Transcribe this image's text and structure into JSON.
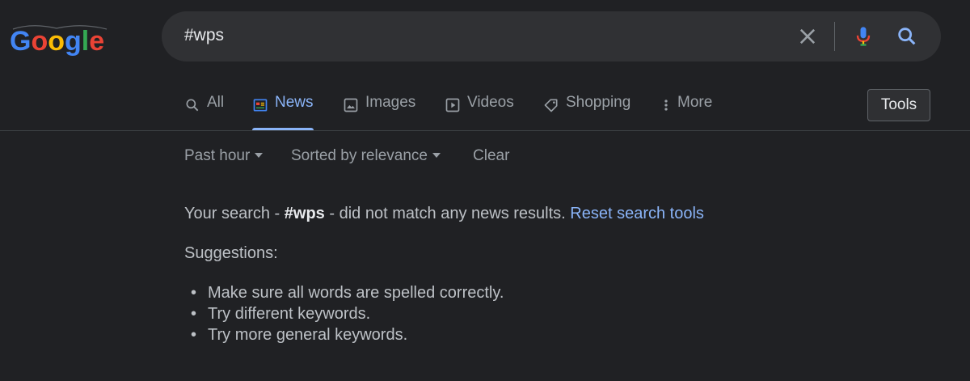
{
  "logo": {
    "text": "Google"
  },
  "search": {
    "query": "#wps"
  },
  "tabs": [
    {
      "label": "All",
      "icon": "search-icon"
    },
    {
      "label": "News",
      "icon": "news-icon",
      "active": true
    },
    {
      "label": "Images",
      "icon": "image-icon"
    },
    {
      "label": "Videos",
      "icon": "video-icon"
    },
    {
      "label": "Shopping",
      "icon": "tag-icon"
    },
    {
      "label": "More",
      "icon": "more-vertical-icon"
    }
  ],
  "tools_label": "Tools",
  "filters": {
    "time": "Past hour",
    "sort": "Sorted by relevance",
    "clear": "Clear"
  },
  "message": {
    "prefix": "Your search - ",
    "query": "#wps",
    "suffix": " - did not match any news results. ",
    "reset_link": "Reset search tools"
  },
  "suggestions": {
    "title": "Suggestions:",
    "items": [
      "Make sure all words are spelled correctly.",
      "Try different keywords.",
      "Try more general keywords."
    ]
  },
  "colors": {
    "background": "#202124",
    "accent": "#8ab4f8",
    "search_bg": "#303134"
  }
}
